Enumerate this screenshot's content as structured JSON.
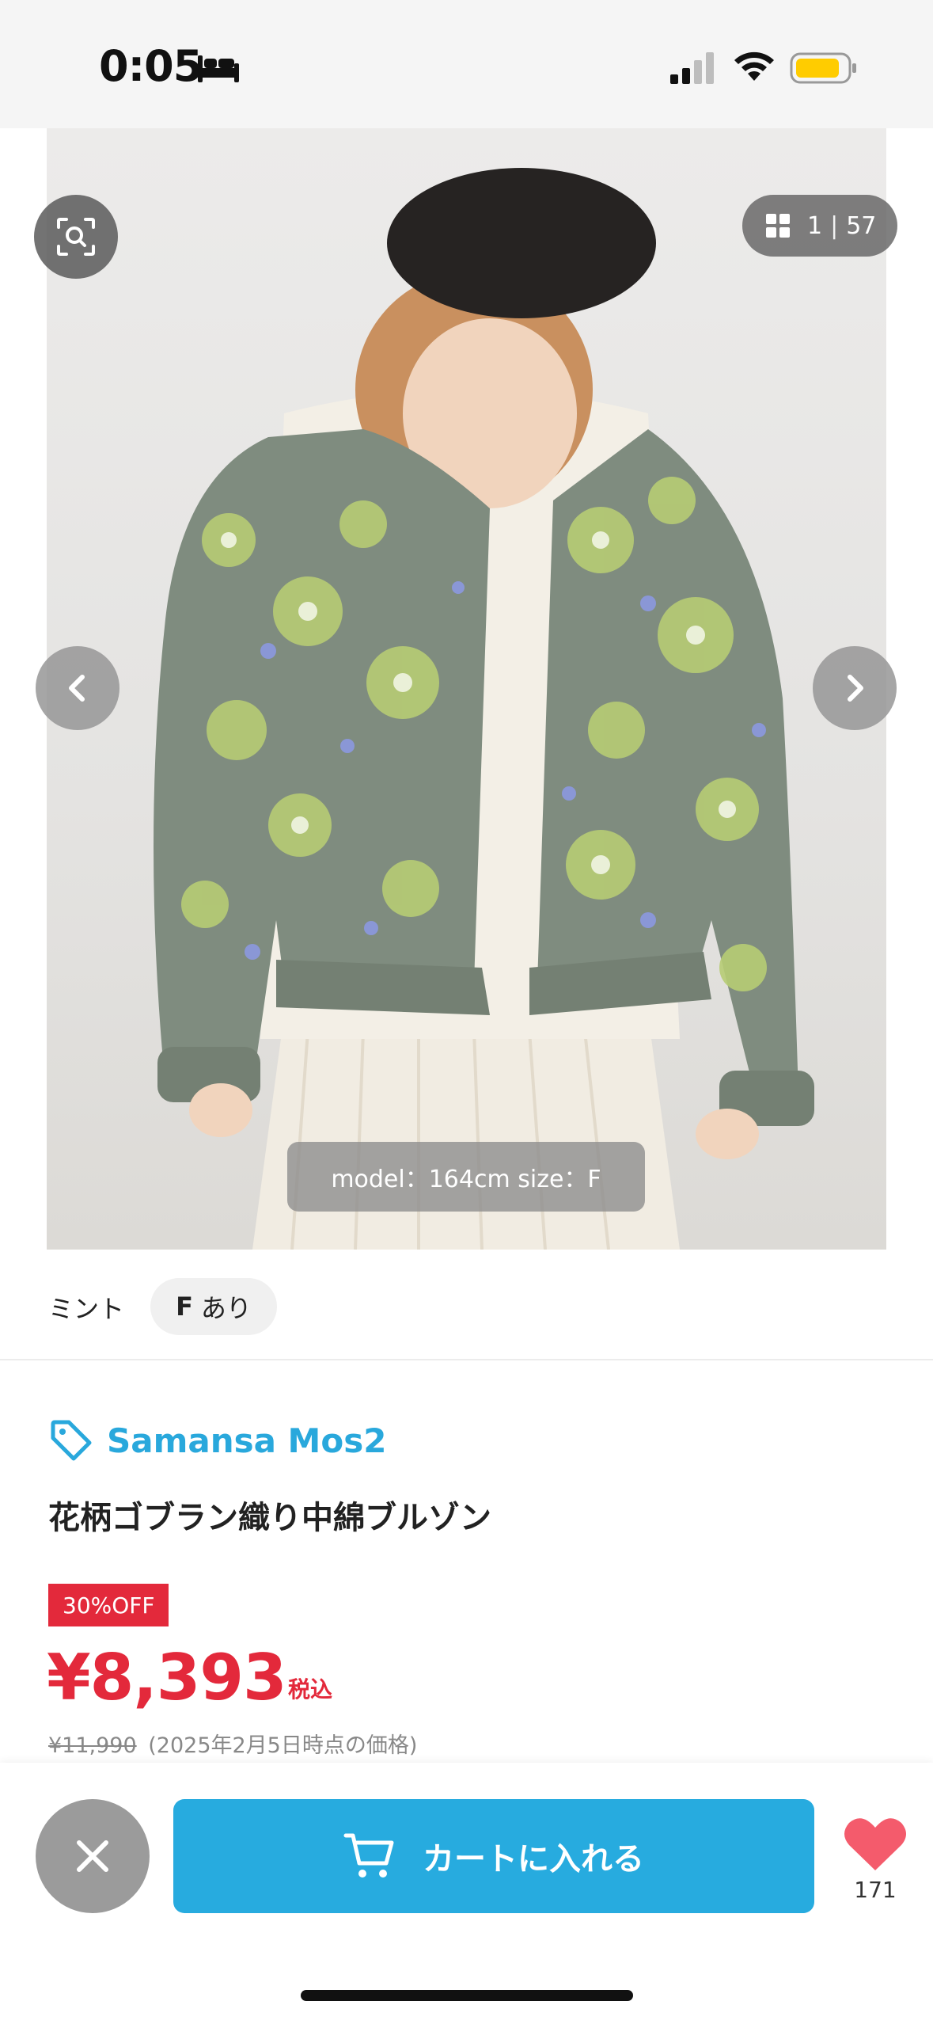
{
  "status_bar": {
    "time": "0:05"
  },
  "gallery": {
    "current": "1",
    "separator": "|",
    "total": "57",
    "caption": "model：164cm size：F"
  },
  "variant": {
    "color": "ミント",
    "size": "F",
    "stock": "あり"
  },
  "product": {
    "brand": "Samansa Mos2",
    "title": "花柄ゴブラン織り中綿ブルゾン",
    "discount": "30%OFF",
    "price": "¥8,393",
    "tax_label": "税込",
    "original_price": "¥11,990",
    "price_note": "(2025年2月5日時点の価格)"
  },
  "bottom_bar": {
    "cart_label": "カートに入れる",
    "favorite_count": "171"
  },
  "colors": {
    "accent": "#27abdf",
    "sale": "#e3293b",
    "heart": "#f45b6c",
    "battery": "#ffcc00"
  }
}
